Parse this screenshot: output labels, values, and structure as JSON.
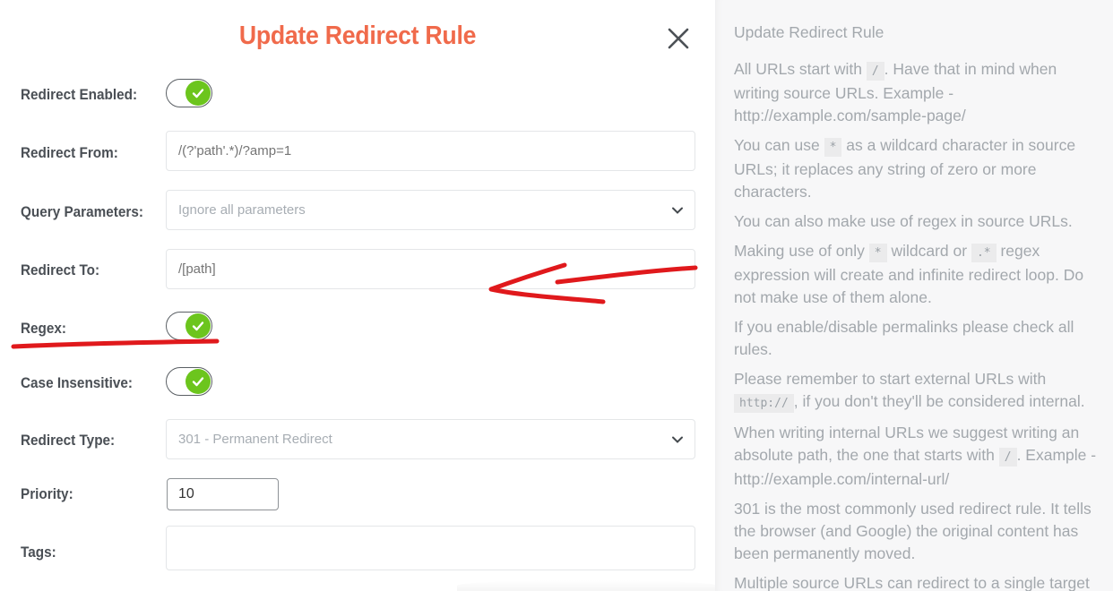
{
  "modal": {
    "title": "Update Redirect Rule",
    "close_icon": "close-icon"
  },
  "form": {
    "redirect_enabled": {
      "label": "Redirect Enabled:",
      "checked": true
    },
    "redirect_from": {
      "label": "Redirect From:",
      "placeholder": "/(?'path'.*)/?amp=1",
      "value": ""
    },
    "query_parameters": {
      "label": "Query Parameters:",
      "selected": "Ignore all parameters"
    },
    "redirect_to": {
      "label": "Redirect To:",
      "placeholder": "/[path]",
      "value": ""
    },
    "regex": {
      "label": "Regex:",
      "checked": true
    },
    "case_insensitive": {
      "label": "Case Insensitive:",
      "checked": true
    },
    "redirect_type": {
      "label": "Redirect Type:",
      "selected": "301 - Permanent Redirect"
    },
    "priority": {
      "label": "Priority:",
      "value": "10"
    },
    "tags": {
      "label": "Tags:",
      "value": ""
    }
  },
  "help": {
    "title": "Update Redirect Rule",
    "p1": {
      "a": "All URLs start with ",
      "code": "/",
      "b": ". Have that in mind when writing source URLs. Example - http://example.com/sample-page/"
    },
    "p2": {
      "a": "You can use ",
      "code": "*",
      "b": " as a wildcard character in source URLs; it replaces any string of zero or more characters."
    },
    "p3": "You can also make use of regex in source URLs.",
    "p4": {
      "a": "Making use of only ",
      "code1": "*",
      "b": " wildcard or ",
      "code2": ".*",
      "c": " regex expression will create and infinite redirect loop. Do not make use of them alone."
    },
    "p5": "If you enable/disable permalinks please check all rules.",
    "p6": {
      "a": "Please remember to start external URLs with ",
      "code": "http://",
      "b": ", if you don't they'll be considered internal."
    },
    "p7": {
      "a": "When writing internal URLs we suggest writing an absolute path, the one that starts with ",
      "code": "/",
      "b": ". Example - http://example.com/internal-url/"
    },
    "p8": "301 is the most commonly used redirect rule. It tells the browser (and Google) the original content has been permanently moved.",
    "p9": "Multiple source URLs can redirect to a single target"
  },
  "colors": {
    "title_accent": "#f06a4b",
    "toggle_on": "#6cc51d",
    "annotation_red": "#e0191c"
  }
}
